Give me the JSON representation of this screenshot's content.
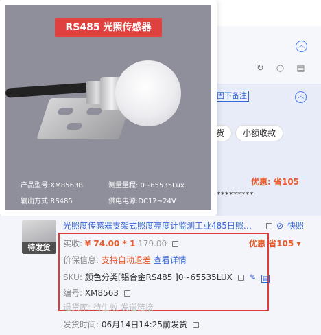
{
  "product_image": {
    "banner": "RS485 光照传感器",
    "spec_model": "产品型号:XM8563B",
    "spec_range": "测量量程: 0~65535Lux",
    "spec_output": "输出方式:RS485",
    "spec_power": "供电电源:DC12~24V"
  },
  "background": {
    "remark_link": "固下备注",
    "pill_a": "货",
    "pill_b": "小额收款",
    "discount_label": "优惠: 省105",
    "masked_text": "*********"
  },
  "product": {
    "thumb_badge": "待发货",
    "title": "光照度传感器支架式照度亮度计监测工业485日照强...",
    "title_action": "快照",
    "paid_label": "实收:",
    "paid_value": "¥ 74.00 * 1",
    "original_price": "179.00",
    "discount_label": "优惠",
    "discount_value": "省105",
    "price_info_label": "价保信息:",
    "price_info_value": "支持自动退差",
    "price_info_link": "查看详情",
    "sku_label": "SKU:",
    "sku_value": "颜色分类[铝合金RS485 ]0~65535LUX",
    "code_label": "编号:",
    "code_value": "XM8563",
    "warehouse_label": "退货库:",
    "warehouse_value": "待生效",
    "warehouse_link": "发送链接",
    "ship_label": "发货时间:",
    "ship_value": "06月14日14:25前发货"
  },
  "icons": {
    "collapse": "chevron-up-icon",
    "refresh": "refresh-icon",
    "search": "search-icon",
    "doc": "document-icon",
    "copy": "copy-icon",
    "link": "link-icon",
    "edit": "pencil-icon",
    "tag": "tag-icon"
  },
  "colors": {
    "accent": "#3665d6",
    "discount": "#e65a2b",
    "highlight_box": "#e03b3b",
    "banner": "#e0403f"
  }
}
